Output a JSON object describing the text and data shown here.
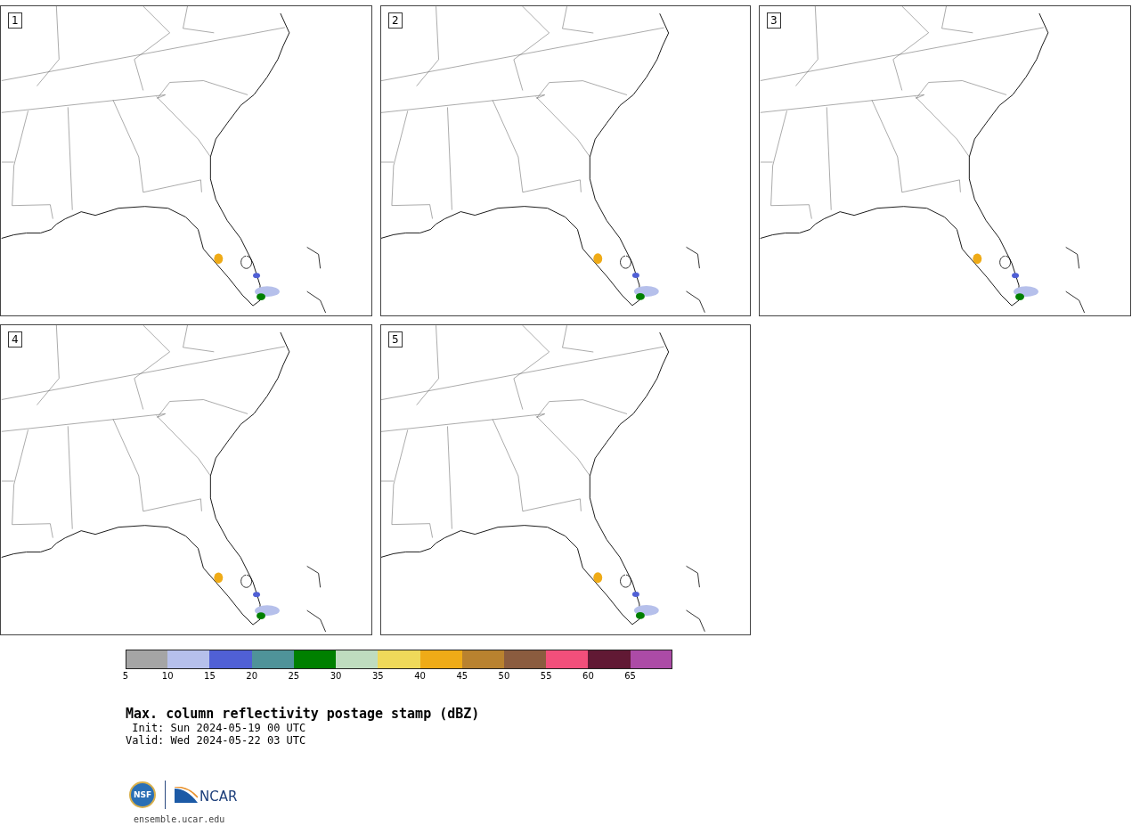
{
  "panels": [
    {
      "label": "1"
    },
    {
      "label": "2"
    },
    {
      "label": "3"
    },
    {
      "label": "4"
    },
    {
      "label": "5"
    }
  ],
  "colorbar": {
    "bins": [
      {
        "color": "#a5a5a5",
        "tick": "5"
      },
      {
        "color": "#b6c0eb",
        "tick": "10"
      },
      {
        "color": "#5060d5",
        "tick": "15"
      },
      {
        "color": "#4f9399",
        "tick": "20"
      },
      {
        "color": "#008000",
        "tick": "25"
      },
      {
        "color": "#bfdcbf",
        "tick": "30"
      },
      {
        "color": "#efd95a",
        "tick": "35"
      },
      {
        "color": "#efab17",
        "tick": "40"
      },
      {
        "color": "#b9822f",
        "tick": "45"
      },
      {
        "color": "#8b5c3f",
        "tick": "50"
      },
      {
        "color": "#f24f7b",
        "tick": "55"
      },
      {
        "color": "#611934",
        "tick": "60"
      },
      {
        "color": "#ac4ba6",
        "tick": "65"
      }
    ]
  },
  "title": "Max. column reflectivity postage stamp (dBZ)",
  "init": "Init: Sun 2024-05-19 00 UTC",
  "valid": "Valid: Wed 2024-05-22 03 UTC",
  "footer": {
    "nsf_mark": "NSF",
    "partner": "NCAR",
    "site": "ensemble.ucar.edu"
  }
}
